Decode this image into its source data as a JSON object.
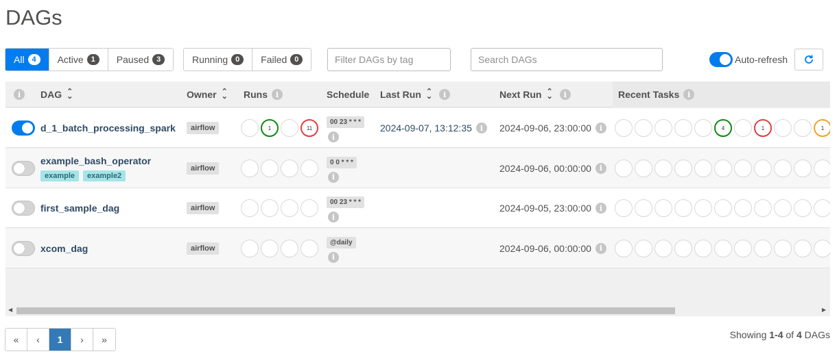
{
  "page": {
    "title": "DAGs"
  },
  "filters": {
    "status": [
      {
        "label": "All",
        "count": "4"
      },
      {
        "label": "Active",
        "count": "1"
      },
      {
        "label": "Paused",
        "count": "3"
      }
    ],
    "runs": [
      {
        "label": "Running",
        "count": "0"
      },
      {
        "label": "Failed",
        "count": "0"
      }
    ],
    "tag_placeholder": "Filter DAGs by tag",
    "search_placeholder": "Search DAGs",
    "auto_refresh_label": "Auto-refresh"
  },
  "table": {
    "headers": {
      "dag": "DAG",
      "owner": "Owner",
      "runs": "Runs",
      "schedule": "Schedule",
      "last_run": "Last Run",
      "next_run": "Next Run",
      "recent_tasks": "Recent Tasks"
    },
    "rows": [
      {
        "name": "d_1_batch_processing_spark",
        "tags": [],
        "owner": "airflow",
        "schedule": "00 23 * * *",
        "last_run": "2024-09-07, 13:12:35",
        "next_run": "2024-09-06, 23:00:00",
        "active": true,
        "runs": [
          "",
          "1",
          "",
          "11"
        ],
        "recent": [
          "",
          "",
          "",
          "",
          "",
          "4",
          "",
          "1",
          "",
          "",
          "1"
        ]
      },
      {
        "name": "example_bash_operator",
        "tags": [
          "example",
          "example2"
        ],
        "owner": "airflow",
        "schedule": "0 0 * * *",
        "last_run": "",
        "next_run": "2024-09-06, 00:00:00",
        "active": false,
        "runs": [
          "",
          "",
          "",
          ""
        ],
        "recent": [
          "",
          "",
          "",
          "",
          "",
          "",
          "",
          "",
          "",
          "",
          ""
        ]
      },
      {
        "name": "first_sample_dag",
        "tags": [],
        "owner": "airflow",
        "schedule": "00 23 * * *",
        "last_run": "",
        "next_run": "2024-09-05, 23:00:00",
        "active": false,
        "runs": [
          "",
          "",
          "",
          ""
        ],
        "recent": [
          "",
          "",
          "",
          "",
          "",
          "",
          "",
          "",
          "",
          "",
          ""
        ]
      },
      {
        "name": "xcom_dag",
        "tags": [],
        "owner": "airflow",
        "schedule": "@daily",
        "last_run": "",
        "next_run": "2024-09-06, 00:00:00",
        "active": false,
        "runs": [
          "",
          "",
          "",
          ""
        ],
        "recent": [
          "",
          "",
          "",
          "",
          "",
          "",
          "",
          "",
          "",
          "",
          ""
        ]
      }
    ]
  },
  "pagination": {
    "first": "«",
    "prev": "‹",
    "current": "1",
    "next": "›",
    "last": "»"
  },
  "footer": {
    "prefix": "Showing ",
    "range": "1-4",
    "middle": " of ",
    "total": "4",
    "suffix": " DAGs"
  }
}
